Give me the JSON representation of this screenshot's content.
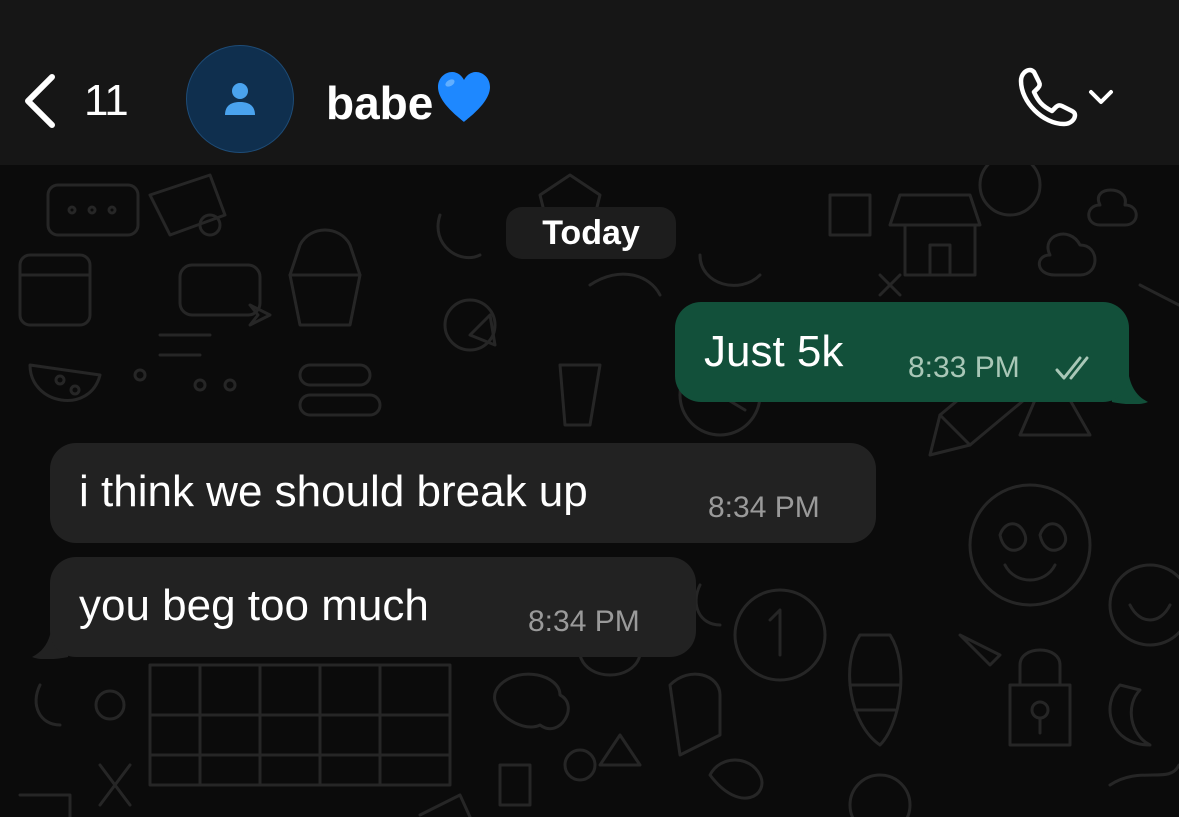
{
  "header": {
    "back_count": "11",
    "contact_name": "babe",
    "heart_icon": "blue-heart-emoji",
    "call_icon": "phone-icon"
  },
  "chat": {
    "date_label": "Today",
    "messages": [
      {
        "direction": "outgoing",
        "text": "Just 5k",
        "time": "8:33 PM",
        "status": "read-double-check"
      },
      {
        "direction": "incoming",
        "text": "i think we should break up",
        "time": "8:34 PM"
      },
      {
        "direction": "incoming",
        "text": "you beg too much",
        "time": "8:34 PM"
      }
    ]
  },
  "colors": {
    "header_bg": "#161616",
    "chat_bg": "#0b0b0b",
    "outgoing_bubble": "#12503a",
    "incoming_bubble": "#222222",
    "avatar_bg": "#0f2f4e",
    "avatar_icon": "#4aa3ee",
    "heart": "#1e88ff"
  }
}
